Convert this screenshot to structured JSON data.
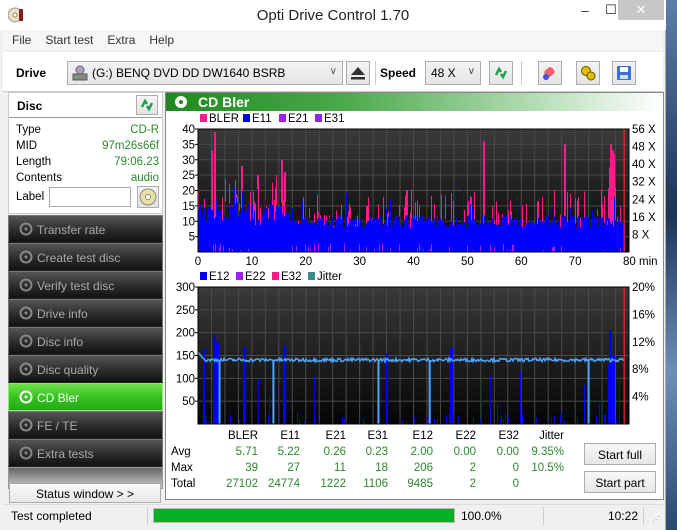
{
  "window": {
    "title": "Opti Drive Control 1.70",
    "controls": {
      "minimize": "‒",
      "maximize": "☐",
      "close": "✕"
    }
  },
  "menu": [
    "File",
    "Start test",
    "Extra",
    "Help"
  ],
  "toolbar": {
    "drive_label": "Drive",
    "drive_value": "(G:)  BENQ DVD DD DW1640 BSRB",
    "speed_label": "Speed",
    "speed_value": "48 X",
    "icons": [
      "drive-icon",
      "eject-icon",
      "refresh-icon",
      "eraser-icon",
      "settings-icon",
      "save-icon"
    ]
  },
  "disc": {
    "title": "Disc",
    "rows": [
      {
        "key": "Type",
        "value": "CD-R"
      },
      {
        "key": "MID",
        "value": "97m26s66f"
      },
      {
        "key": "Length",
        "value": "79:06.23"
      },
      {
        "key": "Contents",
        "value": "audio"
      }
    ],
    "label_key": "Label",
    "label_value": ""
  },
  "nav": [
    {
      "label": "Transfer rate",
      "active": false
    },
    {
      "label": "Create test disc",
      "active": false
    },
    {
      "label": "Verify test disc",
      "active": false
    },
    {
      "label": "Drive info",
      "active": false
    },
    {
      "label": "Disc info",
      "active": false
    },
    {
      "label": "Disc quality",
      "active": false
    },
    {
      "label": "CD Bler",
      "active": true
    },
    {
      "label": "FE / TE",
      "active": false
    },
    {
      "label": "Extra tests",
      "active": false
    }
  ],
  "status_window_label": "Status window > >",
  "panel_title": "CD Bler",
  "chart_data": [
    {
      "type": "bar",
      "title": "",
      "legend": [
        {
          "name": "BLER",
          "color": "#ff1a8c"
        },
        {
          "name": "E11",
          "color": "#0000ff"
        },
        {
          "name": "E21",
          "color": "#a020f0"
        },
        {
          "name": "E31",
          "color": "#8a2be2"
        }
      ],
      "legend_position": "top-left",
      "xlabel": "min",
      "x_ticks": [
        "0",
        "10",
        "20",
        "30",
        "40",
        "50",
        "60",
        "70",
        "80 min"
      ],
      "xlim": [
        0,
        80
      ],
      "ylim": [
        0,
        40
      ],
      "y_ticks": [
        "5",
        "10",
        "15",
        "20",
        "25",
        "30",
        "35",
        "40"
      ],
      "y2_ticks": [
        "8 X",
        "16 X",
        "24 X",
        "32 X",
        "40 X",
        "48 X",
        "56 X"
      ],
      "y2lim": [
        0,
        56
      ],
      "grid": true,
      "series_profile": {
        "BLER_peaks": [
          [
            2.5,
            33
          ],
          [
            3,
            39
          ],
          [
            8,
            28
          ],
          [
            11,
            25
          ],
          [
            15.5,
            30
          ],
          [
            16,
            26
          ],
          [
            53,
            36
          ],
          [
            68,
            35
          ],
          [
            76.5,
            35
          ],
          [
            77,
            33
          ]
        ],
        "E11_baseline_range": [
          8,
          12
        ],
        "end_marker_min": 79.1
      }
    },
    {
      "type": "bar",
      "legend": [
        {
          "name": "E12",
          "color": "#0000ff"
        },
        {
          "name": "E22",
          "color": "#a020f0"
        },
        {
          "name": "E32",
          "color": "#ff1a8c"
        },
        {
          "name": "Jitter",
          "color": "#3a8a8a"
        }
      ],
      "legend_position": "top-left",
      "xlabel": "min",
      "x_ticks": [
        "0",
        "10",
        "20",
        "30",
        "40",
        "50",
        "60",
        "70",
        "80 min"
      ],
      "xlim": [
        0,
        80
      ],
      "ylim": [
        0,
        300
      ],
      "y_ticks": [
        "50",
        "100",
        "150",
        "200",
        "250",
        "300"
      ],
      "y2_ticks": [
        "4%",
        "8%",
        "12%",
        "16%",
        "20%"
      ],
      "y2lim": [
        0,
        20
      ],
      "grid": true,
      "series_profile": {
        "E12_peaks": [
          [
            1,
            165
          ],
          [
            3,
            195
          ],
          [
            3.5,
            180
          ],
          [
            8.5,
            170
          ],
          [
            16,
            172
          ],
          [
            35,
            155
          ],
          [
            47,
            165
          ],
          [
            76.5,
            206
          ],
          [
            77,
            150
          ]
        ],
        "jitter_level_pct": 9.35,
        "jitter_dips_min": [
          4,
          14,
          33.5,
          43,
          72.5
        ],
        "end_marker_min": 79.1
      }
    }
  ],
  "stats": {
    "columns": [
      "BLER",
      "E11",
      "E21",
      "E31",
      "E12",
      "E22",
      "E32",
      "Jitter"
    ],
    "rows": [
      {
        "label": "Avg",
        "values": [
          "5.71",
          "5.22",
          "0.26",
          "0.23",
          "2.00",
          "0.00",
          "0.00",
          "9.35%"
        ]
      },
      {
        "label": "Max",
        "values": [
          "39",
          "27",
          "11",
          "18",
          "206",
          "2",
          "0",
          "10.5%"
        ]
      },
      {
        "label": "Total",
        "values": [
          "27102",
          "24774",
          "1222",
          "1106",
          "9485",
          "2",
          "0",
          ""
        ]
      }
    ]
  },
  "buttons": {
    "start_full": "Start full",
    "start_part": "Start part"
  },
  "statusbar": {
    "text": "Test completed",
    "progress": 1.0,
    "progress_label": "100.0%",
    "time": "10:22"
  }
}
